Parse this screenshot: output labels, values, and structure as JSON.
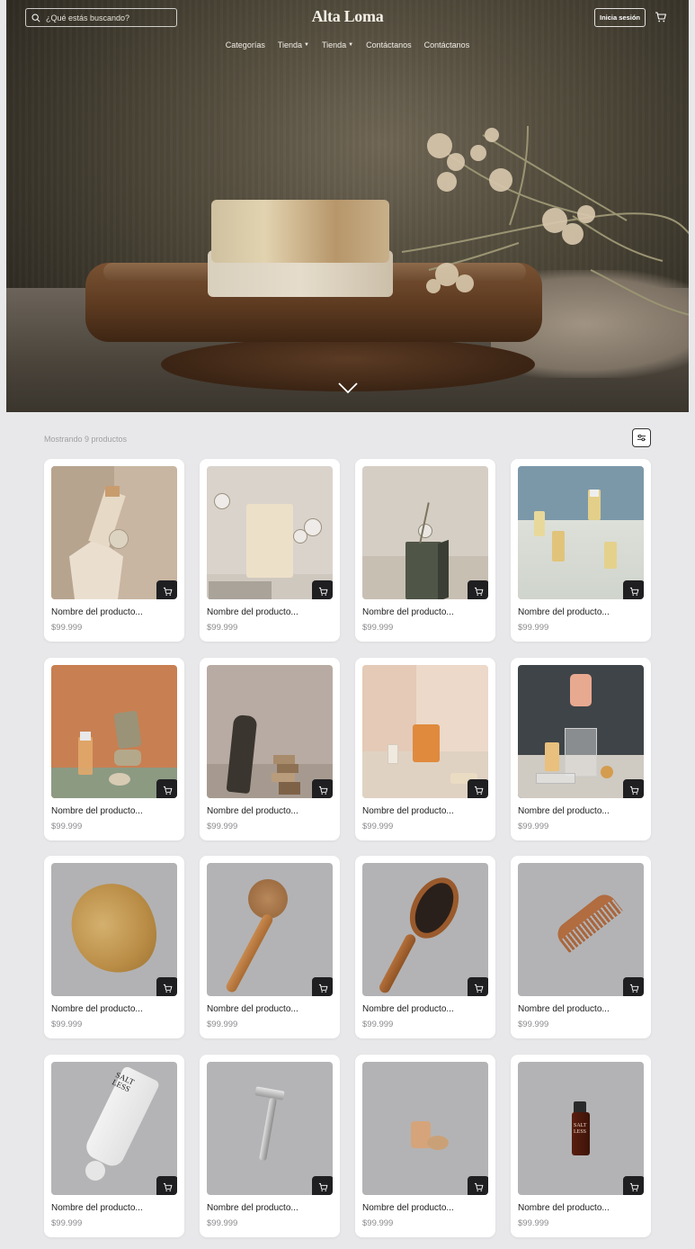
{
  "header": {
    "search_placeholder": "¿Qué estás buscando?",
    "brand": "Alta Loma",
    "login_label": "Inicia sesión",
    "nav": [
      {
        "label": "Categorías",
        "dropdown": false
      },
      {
        "label": "Tienda",
        "dropdown": true
      },
      {
        "label": "Tienda",
        "dropdown": true
      },
      {
        "label": "Contáctanos",
        "dropdown": false
      },
      {
        "label": "Contáctanos",
        "dropdown": false
      }
    ]
  },
  "listing": {
    "count_text": "Mostrando 9 productos",
    "products": [
      {
        "name": "Nombre del producto...",
        "price": "$99.999",
        "scene": "beige-blocks"
      },
      {
        "name": "Nombre del producto...",
        "price": "$99.999",
        "scene": "cream-soap-lunaria"
      },
      {
        "name": "Nombre del producto...",
        "price": "$99.999",
        "scene": "green-block"
      },
      {
        "name": "Nombre del producto...",
        "price": "$99.999",
        "scene": "blue-serum-bottles"
      },
      {
        "name": "Nombre del producto...",
        "price": "$99.999",
        "scene": "orange-serum-rocks"
      },
      {
        "name": "Nombre del producto...",
        "price": "$99.999",
        "scene": "wood-stack-rock"
      },
      {
        "name": "Nombre del producto...",
        "price": "$99.999",
        "scene": "orange-soap-bar"
      },
      {
        "name": "Nombre del producto...",
        "price": "$99.999",
        "scene": "pink-salt-bottle"
      },
      {
        "name": "Nombre del producto...",
        "price": "$99.999",
        "scene": "sea-sponge"
      },
      {
        "name": "Nombre del producto...",
        "price": "$99.999",
        "scene": "bath-brush"
      },
      {
        "name": "Nombre del producto...",
        "price": "$99.999",
        "scene": "hair-brush"
      },
      {
        "name": "Nombre del producto...",
        "price": "$99.999",
        "scene": "wooden-comb"
      },
      {
        "name": "Nombre del producto...",
        "price": "$99.999",
        "scene": "cream-tube"
      },
      {
        "name": "Nombre del producto...",
        "price": "$99.999",
        "scene": "safety-razor"
      },
      {
        "name": "Nombre del producto...",
        "price": "$99.999",
        "scene": "solid-shampoo"
      },
      {
        "name": "Nombre del producto...",
        "price": "$99.999",
        "scene": "pump-bottle"
      }
    ]
  },
  "colors": {
    "page_bg": "#e8e8ea",
    "card_bg": "#ffffff",
    "cart_button": "#1f1f22",
    "price_text": "#8a8a8e"
  },
  "icons": {
    "search": "search-icon",
    "cart": "cart-icon",
    "filter": "sliders-icon",
    "scroll": "chevron-down-icon"
  },
  "tube_text": "SALT LESS",
  "bottle_label": "SALT LESS"
}
